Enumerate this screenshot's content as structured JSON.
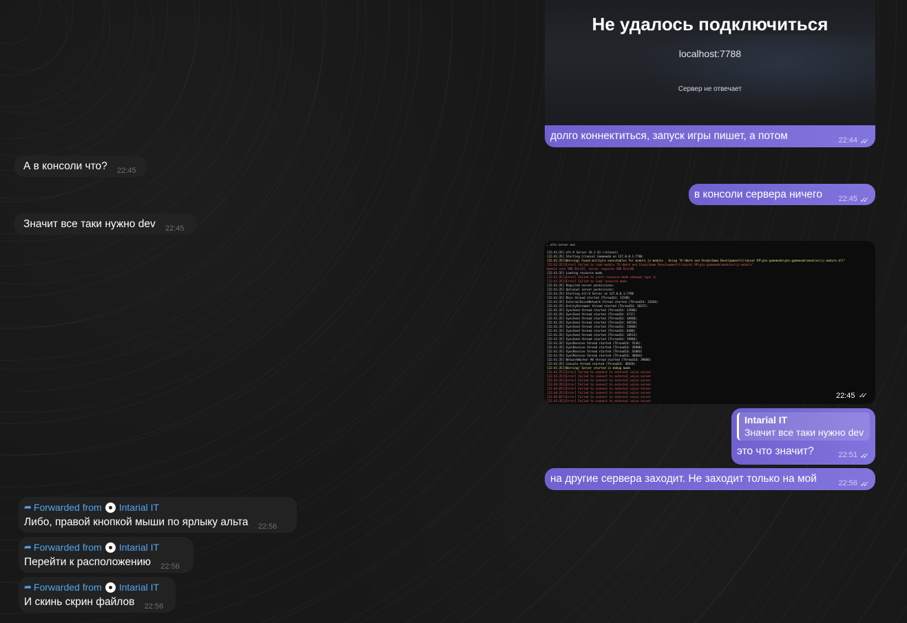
{
  "colors": {
    "background": "#181818",
    "incoming_bubble": "#222222",
    "outgoing_bubble": "#7b6fd6",
    "forward_link": "#4ea7f0"
  },
  "error_screenshot": {
    "title": "Не удалось подключиться",
    "host": "localhost:7788",
    "subtitle": "Сервер не отвечает"
  },
  "messages": {
    "out1": {
      "text": "долго коннектиться, запуск игры пишет, а потом",
      "time": "22:44"
    },
    "in1": {
      "text": "А в консоли что?",
      "time": "22:45"
    },
    "out2": {
      "text": "в консоли сервера ничего",
      "time": "22:45"
    },
    "in2": {
      "text": "Значит все таки нужно dev",
      "time": "22:45"
    },
    "console": {
      "title": "⌄ altv-server.exe",
      "time": "22:45",
      "lines": [
        {
          "t": "[22:41:35] alt:V Server 16.2.43 (release)",
          "c": "info"
        },
        {
          "t": "[22:41:35] Starting Criminal Gamemode on 127.0.0.1:7788",
          "c": "info"
        },
        {
          "t": "[22:41:35][Warning] Found multiple executables for module js-module . Using \"D:\\Work and Study\\Game Development\\Criminal RP\\gta-gamemode\\gta-gamemode\\modules\\js-module.dll\"",
          "c": "warn"
        },
        {
          "t": "[22:41:35][Error] Failed to load module \"D:\\Work and Study\\Game Development\\Criminal RP\\gta-gamemode\\modules\\js-module\"",
          "c": "err"
        },
        {
          "t": "    module uses SDK 0[x]47, server requires SDK 0[x]48",
          "c": "err"
        },
        {
          "t": "[22:41:35] Loading resource mode",
          "c": "info"
        },
        {
          "t": "[22:41:35][Error] Failed to start resource mode unknown type js",
          "c": "err"
        },
        {
          "t": "[22:41:35][Error] Failed to load resource mode",
          "c": "err"
        },
        {
          "t": "[22:41:35] Required server permissions:",
          "c": "info"
        },
        {
          "t": "[22:41:35] Optional server permissions:",
          "c": "info"
        },
        {
          "t": "[22:41:35] Starting alt:V Server on 127.0.0.1:7788",
          "c": "info"
        },
        {
          "t": "[22:41:35] Main thread started (ThreadId: 11590)",
          "c": "info"
        },
        {
          "t": "[22:41:35] ExternalVoiceNetwork thread started (ThreadId: 12020)",
          "c": "info"
        },
        {
          "t": "[22:41:35] EntityStreamer thread started (ThreadId: 20372)",
          "c": "info"
        },
        {
          "t": "[22:41:35] SyncSend thread started (ThreadId: 12980)",
          "c": "info"
        },
        {
          "t": "[22:41:35] SyncSend thread started (ThreadId: 4717)",
          "c": "info"
        },
        {
          "t": "[22:41:35] SyncSend thread started (ThreadId: 18468)",
          "c": "info"
        },
        {
          "t": "[22:41:35] SyncSend thread started (ThreadId: 40520)",
          "c": "info"
        },
        {
          "t": "[22:41:35] SyncSend thread started (ThreadId: 15868)",
          "c": "info"
        },
        {
          "t": "[22:41:35] SyncSend thread started (ThreadId: 8408)",
          "c": "info"
        },
        {
          "t": "[22:41:35] SyncSend thread started (ThreadId: 10512)",
          "c": "info"
        },
        {
          "t": "[22:41:35] SyncSend thread started (ThreadId: 19984)",
          "c": "info"
        },
        {
          "t": "[22:41:35] SyncReceive thread started (ThreadId: 5536)",
          "c": "info"
        },
        {
          "t": "[22:41:35] SyncReceive thread started (ThreadId: 39908)",
          "c": "info"
        },
        {
          "t": "[22:41:35] SyncReceive thread started (ThreadId: 43884)",
          "c": "info"
        },
        {
          "t": "[22:41:35] SyncReceive thread started (ThreadId: 40604)",
          "c": "info"
        },
        {
          "t": "[22:41:35] NetworkWorker #0 thread started (ThreadId: 39800)",
          "c": "info"
        },
        {
          "t": "[22:41:35] Console thread started (ThreadId: 46928)",
          "c": "info"
        },
        {
          "t": "[22:41:35][Warning] Server started in debug mode",
          "c": "warn"
        },
        {
          "t": "[22:41:35][Error] Failed to connect to external voice server",
          "c": "err"
        },
        {
          "t": "[22:42:35][Error] Failed to connect to external voice server",
          "c": "err"
        },
        {
          "t": "[22:42:35][Error] Failed to connect to external voice server",
          "c": "err"
        },
        {
          "t": "[22:43:35][Error] Failed to connect to external voice server",
          "c": "err"
        },
        {
          "t": "[22:44:05][Error] Failed to connect to external voice server",
          "c": "err"
        },
        {
          "t": "[22:44:35][Error] Failed to connect to external voice server",
          "c": "err"
        },
        {
          "t": "[22:45:05][Error] Failed to connect to external voice server",
          "c": "err"
        },
        {
          "t": "[22:45:35][Error] Failed to connect to external voice server",
          "c": "err"
        }
      ]
    },
    "reply": {
      "quote_author": "Intarial IT",
      "quote_text": "Значит все таки нужно dev",
      "text": "это что значит?",
      "time": "22:51"
    },
    "out3": {
      "text": "на другие сервера заходит. Не заходит только на мой",
      "time": "22:56"
    },
    "fwd1": {
      "label": "Forwarded from",
      "from": "Intarial IT",
      "text": "Либо, правой кнопкой мыши по ярлыку альта",
      "time": "22:56"
    },
    "fwd2": {
      "label": "Forwarded from",
      "from": "Intarial IT",
      "text": "Перейти к расположению",
      "time": "22:56"
    },
    "fwd3": {
      "label": "Forwarded from",
      "from": "Intarial IT",
      "text": "И скинь скрин файлов",
      "time": "22:56"
    }
  }
}
